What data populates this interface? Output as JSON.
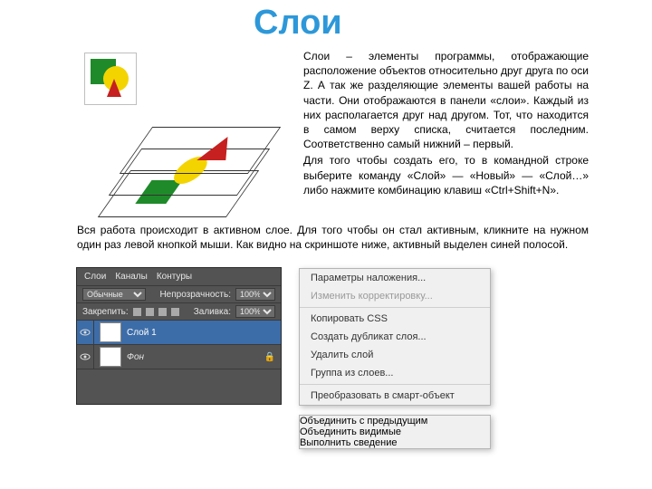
{
  "title": "Слои",
  "intro_p1": "Слои – элементы программы, отображающие расположение объектов относительно друг друга по оси Z. А так же разделяющие элементы вашей работы на части. Они отображаются в панели «слои». Каждый из них располагается друг над другом. Тот, что находится в самом верху списка, считается последним. Соответственно самый нижний – первый.",
  "intro_p2": "Для того чтобы создать его, то в командной строке выберите команду «Слой» — «Новый» — «Слой…» либо нажмите комбинацию клавиш «Ctrl+Shift+N».",
  "para2": "Вся работа происходит в активном слое. Для того чтобы он стал активным, кликните на нужном один раз левой кнопкой мыши. Как видно на скриншоте ниже, активный выделен синей полосой.",
  "panel": {
    "tabs": [
      "Слои",
      "Каналы",
      "Контуры"
    ],
    "mode_label": "Обычные",
    "opacity_label": "Непрозрачность:",
    "opacity_value": "100%",
    "lock_label": "Закрепить:",
    "fill_label": "Заливка:",
    "fill_value": "100%",
    "layers": [
      {
        "name": "Слой 1",
        "active": true
      },
      {
        "name": "Фон",
        "active": false
      }
    ]
  },
  "ctx": [
    {
      "label": "Параметры наложения...",
      "disabled": false
    },
    {
      "label": "Изменить корректировку...",
      "disabled": true
    },
    {
      "sep": true
    },
    {
      "label": "Копировать CSS",
      "disabled": false
    },
    {
      "label": "Создать дубликат слоя...",
      "disabled": false
    },
    {
      "label": "Удалить слой",
      "disabled": false
    },
    {
      "label": "Группа из слоев...",
      "disabled": false
    },
    {
      "sep": true
    },
    {
      "label": "Преобразовать в смарт-объект",
      "disabled": false
    }
  ],
  "ctx2": [
    {
      "label": "Объединить с предыдущим"
    },
    {
      "label": "Объединить видимые"
    },
    {
      "label": "Выполнить сведение"
    }
  ]
}
